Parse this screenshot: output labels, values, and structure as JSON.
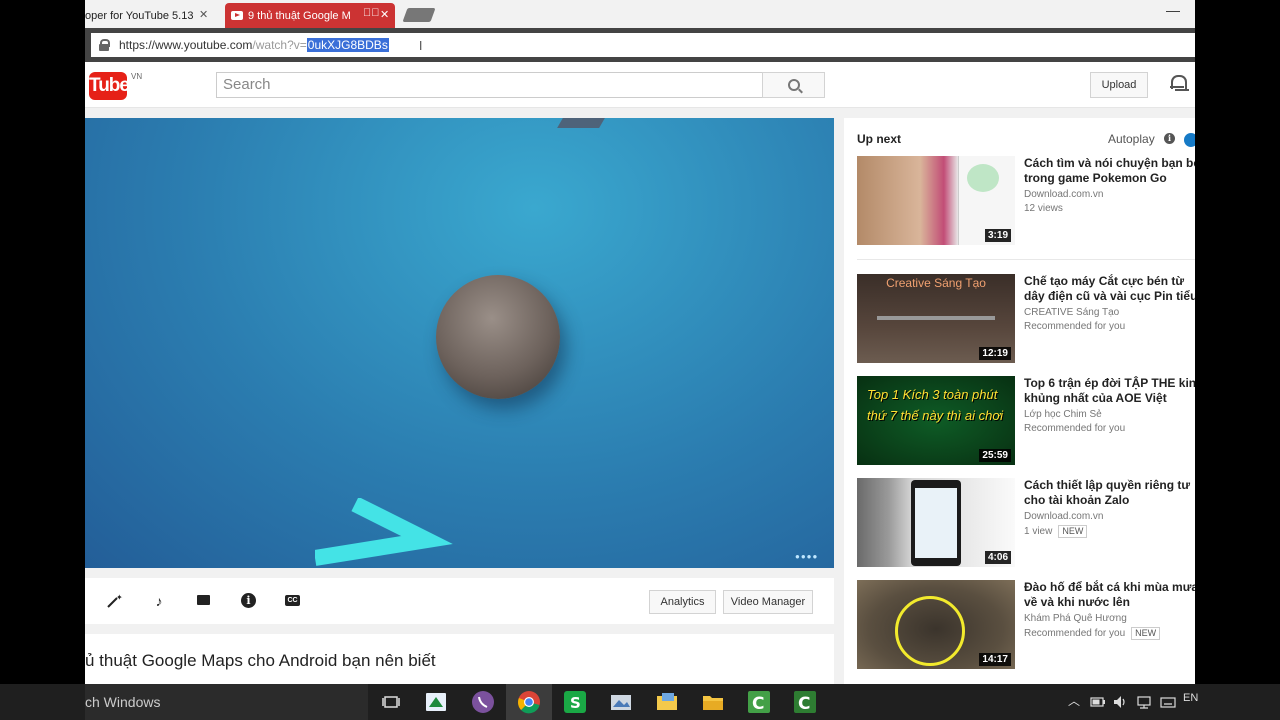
{
  "browser": {
    "tabs": [
      {
        "title": "oper for YouTube 5.13",
        "active": false
      },
      {
        "title": "9 thủ thuật Google M",
        "active": true
      }
    ],
    "url": {
      "prefix": "https://www.youtube.com",
      "path": "/watch?v=",
      "selected": "0ukXJG8BDBs"
    }
  },
  "youtube": {
    "logo_text": "Tube",
    "country": "VN",
    "search_placeholder": "Search",
    "upload_label": "Upload"
  },
  "creator_bar": {
    "analytics_label": "Analytics",
    "video_manager_label": "Video Manager"
  },
  "video": {
    "title": "ủ thuật Google Maps cho Android bạn nên biết"
  },
  "sidebar": {
    "up_next_label": "Up next",
    "autoplay_label": "Autoplay",
    "videos": [
      {
        "title": "Cách tìm và nói chuyện bạn bè trong game Pokemon Go",
        "channel": "Download.com.vn",
        "meta": "12 views",
        "duration": "3:19",
        "badge": ""
      },
      {
        "title": "Chế tạo máy Cắt cực bén từ dây điện cũ và vài cục Pin tiểu",
        "channel": "CREATIVE Sáng Tạo",
        "meta": "Recommended for you",
        "duration": "12:19",
        "badge": "",
        "thumb_caption": "Creative Sáng Tạo"
      },
      {
        "title": "Top 6 trận ép đời TẬP THE kinh khủng nhất của AOE Việt",
        "channel": "Lớp học Chim Sẻ",
        "meta": "Recommended for you",
        "duration": "25:59",
        "badge": "",
        "thumb_caption": "Top 1 Kích 3 toàn phút thứ 7 thế này thì ai chơi"
      },
      {
        "title": "Cách thiết lập quyền riêng tư cho tài khoản Zalo",
        "channel": "Download.com.vn",
        "meta": "1 view",
        "duration": "4:06",
        "badge": "NEW"
      },
      {
        "title": "Đào hố để bắt cá khi mùa mưa về và khi nước lên",
        "channel": "Khám Phá Quê Hương",
        "meta": "Recommended for you",
        "duration": "14:17",
        "badge": "NEW"
      }
    ]
  },
  "taskbar": {
    "search_text": "ch Windows",
    "language": "EN"
  }
}
